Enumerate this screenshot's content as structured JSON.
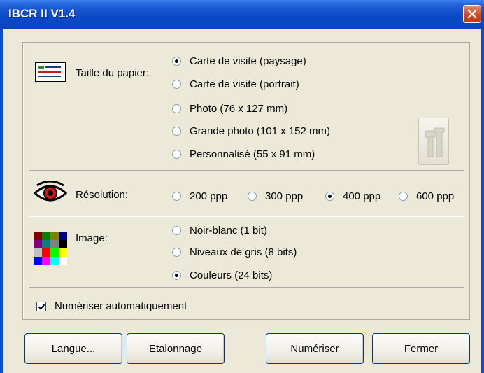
{
  "window": {
    "title": "IBCR II V1.4"
  },
  "paper": {
    "label": "Taille du papier:",
    "options": [
      {
        "label": "Carte de visite (paysage)",
        "checked": true
      },
      {
        "label": "Carte de visite (portrait)",
        "checked": false
      },
      {
        "label": "Photo (76 x 127 mm)",
        "checked": false
      },
      {
        "label": "Grande photo (101 x 152 mm)",
        "checked": false
      },
      {
        "label": "Personnalisé  (55 x 91 mm)",
        "checked": false
      }
    ]
  },
  "resolution": {
    "label": "Résolution:",
    "options": [
      {
        "label": "200 ppp",
        "checked": false
      },
      {
        "label": "300 ppp",
        "checked": false
      },
      {
        "label": "400 ppp",
        "checked": true
      },
      {
        "label": "600 ppp",
        "checked": false
      }
    ]
  },
  "image": {
    "label": "Image:",
    "options": [
      {
        "label": "Noir-blanc (1 bit)",
        "checked": false
      },
      {
        "label": "Niveaux de gris (8 bits)",
        "checked": false
      },
      {
        "label": "Couleurs (24 bits)",
        "checked": true
      }
    ]
  },
  "auto_scan": {
    "label": "Numériser automatiquement",
    "checked": true
  },
  "buttons": {
    "language": "Langue...",
    "calibration": "Etalonnage",
    "scan": "Numériser",
    "close": "Fermer"
  },
  "colors": {
    "titlebar": "#0a48c8",
    "window_bg": "#ece9d8",
    "close_button": "#d0451b"
  }
}
